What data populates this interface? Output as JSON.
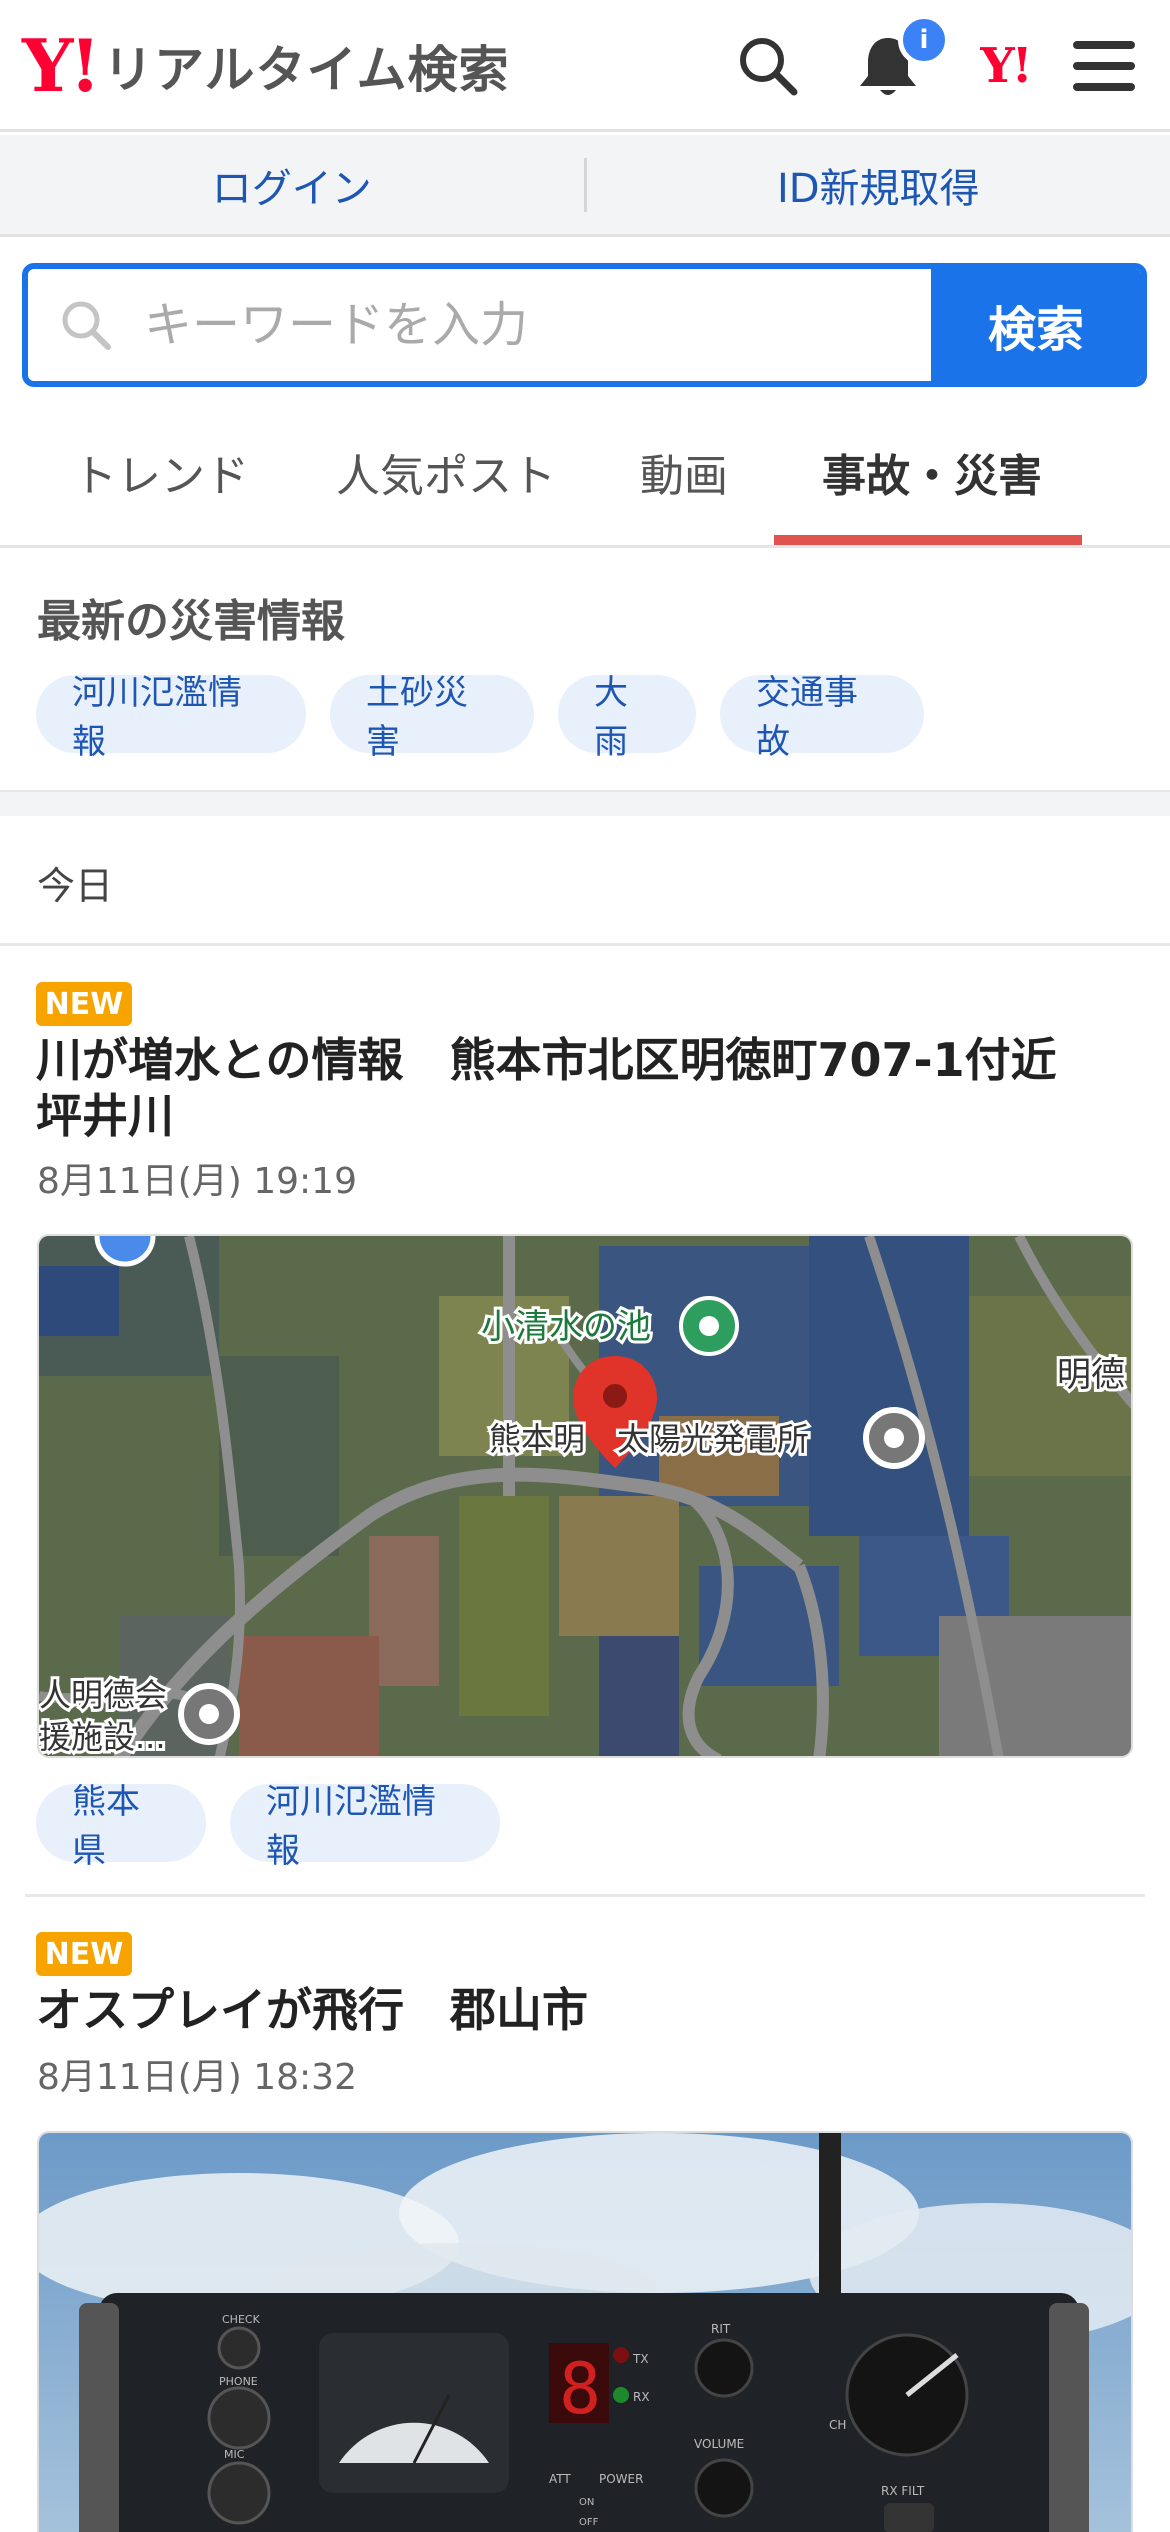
{
  "header": {
    "logo_mark": "Y!",
    "logo_text": "リアルタイム検索",
    "notification_badge": "i",
    "yj_mark": "Y!"
  },
  "auth": {
    "login_label": "ログイン",
    "register_label": "ID新規取得"
  },
  "search": {
    "placeholder": "キーワードを入力",
    "button_label": "検索"
  },
  "tabs": [
    {
      "label": "トレンド"
    },
    {
      "label": "人気ポスト"
    },
    {
      "label": "動画"
    },
    {
      "label": "事故・災害",
      "active": true
    }
  ],
  "disaster": {
    "title": "最新の災害情報",
    "chips": [
      "河川氾濫情報",
      "土砂災害",
      "大雨",
      "交通事故"
    ]
  },
  "feed": {
    "day_label": "今日",
    "articles": [
      {
        "badge": "NEW",
        "title": "川が増水との情報　熊本市北区明徳町707-1付近　坪井川",
        "date": "8月11日(月) 19:19",
        "map_labels": {
          "pond": "小清水の池",
          "solar": "熊本明　太陽光発電所",
          "right": "明德",
          "facility_1": "人明德会",
          "facility_2": "援施設..."
        },
        "tags": [
          "熊本県",
          "河川氾濫情報"
        ]
      },
      {
        "badge": "NEW",
        "title": "オスプレイが飛行　郡山市",
        "date": "8月11日(月) 18:32",
        "device_labels": {
          "check": "CHECK",
          "phone": "PHONE",
          "mic": "MIC",
          "rit": "RIT",
          "volume": "VOLUME",
          "att": "ATT",
          "power": "POWER",
          "rx_filt": "RX FILT",
          "tx": "TX",
          "rx": "RX",
          "ch": "CH",
          "on": "ON",
          "off": "OFF",
          "digit": "8"
        }
      }
    ]
  },
  "colors": {
    "brand_red": "#ff0033",
    "primary_blue": "#1a73e8",
    "link_blue": "#1e56b3",
    "tab_active_underline": "#e0534f",
    "new_badge": "#f7a400",
    "chip_bg": "#e8f0fb"
  }
}
